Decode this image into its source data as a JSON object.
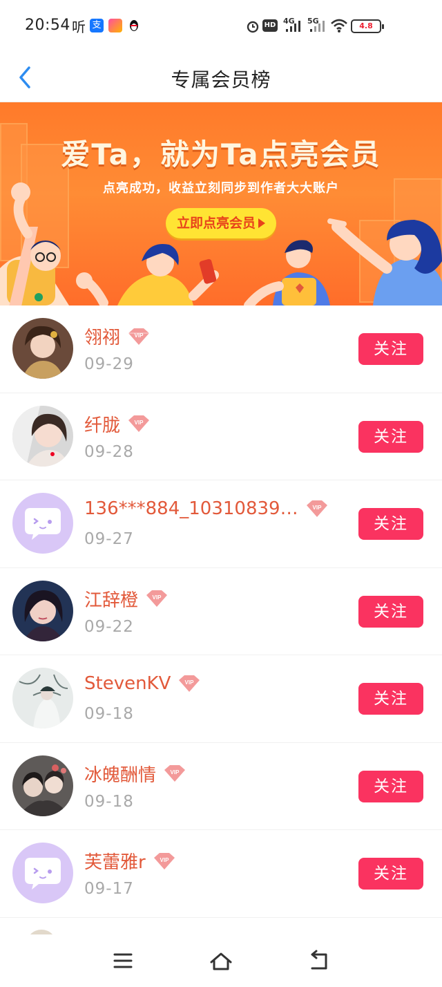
{
  "status_bar": {
    "time": "20:54",
    "carrier_char": "听",
    "app_icons": [
      "alipay-icon",
      "gallery-app-icon",
      "qq-icon"
    ],
    "hd_label": "HD",
    "net_4g": "4G",
    "net_5g": "5G",
    "battery": "4.8"
  },
  "header": {
    "title": "专属会员榜",
    "back_icon": "chevron-left-icon"
  },
  "banner": {
    "headline": "爱Ta，就为Ta点亮会员",
    "subline": "点亮成功，收益立刻同步到作者大大账户",
    "cta": "立即点亮会员"
  },
  "members": [
    {
      "name": "翎祤",
      "date": "09-29",
      "follow": "关注",
      "avatar": "photo"
    },
    {
      "name": "纤胧",
      "date": "09-28",
      "follow": "关注",
      "avatar": "photo"
    },
    {
      "name": "136***884_10310839…",
      "date": "09-27",
      "follow": "关注",
      "avatar": "default"
    },
    {
      "name": "江辞橙",
      "date": "09-22",
      "follow": "关注",
      "avatar": "photo"
    },
    {
      "name": "StevenKV",
      "date": "09-18",
      "follow": "关注",
      "avatar": "photo"
    },
    {
      "name": "冰魄酬情",
      "date": "09-18",
      "follow": "关注",
      "avatar": "photo"
    },
    {
      "name": "芙蕾雅r",
      "date": "09-17",
      "follow": "关注",
      "avatar": "default"
    }
  ],
  "vip_label": "VIP",
  "colors": {
    "accent": "#fa3360",
    "name": "#e2593a",
    "date": "#a9a9a9",
    "banner": "#ff7a2a",
    "back_icon": "#2d8cf0"
  },
  "nav": [
    "menu-icon",
    "home-icon",
    "back-icon"
  ]
}
